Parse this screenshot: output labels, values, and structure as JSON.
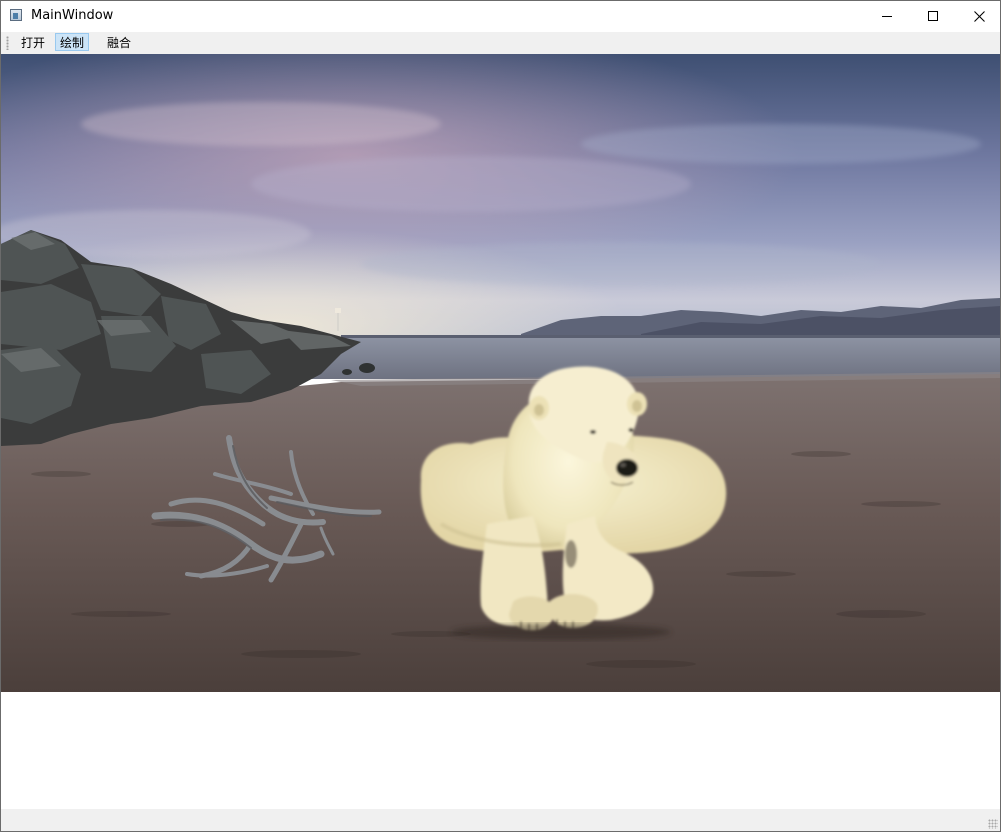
{
  "window": {
    "title": "MainWindow"
  },
  "toolbar": {
    "open_label": "打开",
    "draw_label": "绘制",
    "fuse_label": "融合",
    "active_item": "绘制"
  },
  "colors": {
    "toolbar_bg": "#f0f0f0",
    "active_button_bg": "#cce4f7",
    "active_button_border": "#99c9ef"
  },
  "icons": {
    "app": "window-app-icon",
    "minimize": "minimize-icon",
    "maximize": "maximize-icon",
    "close": "close-icon"
  }
}
